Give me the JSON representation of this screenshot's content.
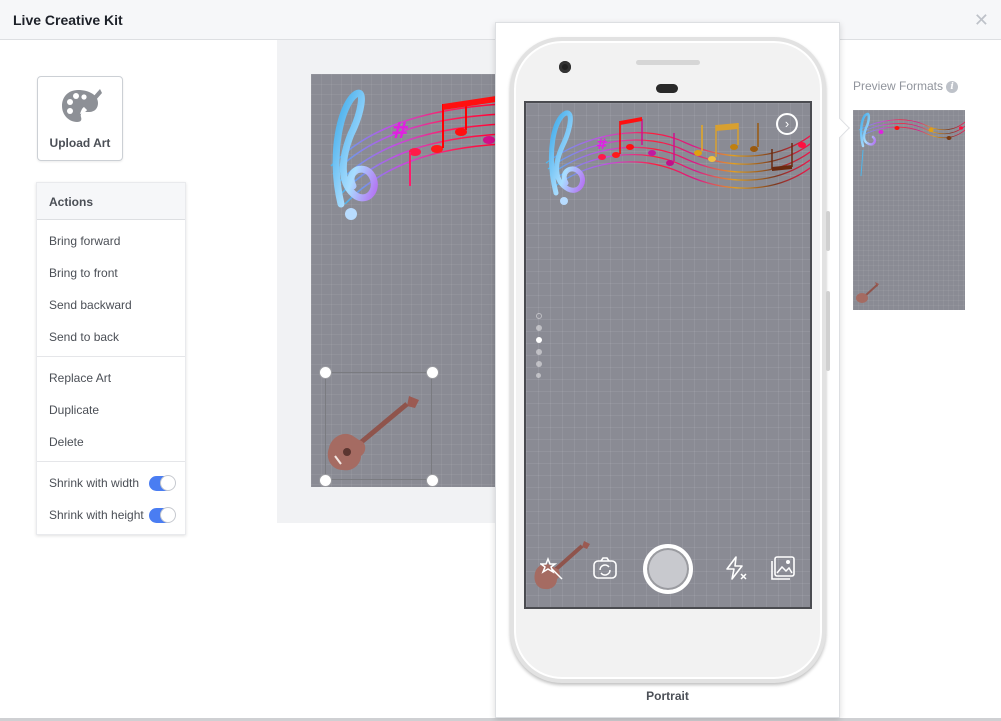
{
  "window": {
    "title": "Live Creative Kit",
    "close_icon": "close-icon"
  },
  "sidebar": {
    "upload_art": {
      "label": "Upload Art",
      "icon": "palette-icon"
    },
    "actions": {
      "header": "Actions",
      "groups": [
        [
          "Bring forward",
          "Bring to front",
          "Send backward",
          "Send to back"
        ],
        [
          "Replace Art",
          "Duplicate",
          "Delete"
        ]
      ],
      "toggles": [
        {
          "label": "Shrink with width",
          "on": true
        },
        {
          "label": "Shrink with height",
          "on": true
        }
      ]
    }
  },
  "canvas": {
    "layers": [
      "music-staff-art",
      "ukulele-art"
    ],
    "selected_layer": "ukulele-art"
  },
  "preview": {
    "format_label": "Portrait",
    "next_icon": "chevron-right-icon",
    "filter_dots": {
      "count": 6,
      "active_index": 2
    },
    "controls": [
      "effects-icon",
      "flip-camera-icon",
      "shutter-button",
      "flash-off-icon",
      "gallery-icon"
    ]
  },
  "preview_formats": {
    "label": "Preview Formats",
    "info_icon": "info-icon",
    "info_glyph": "i"
  },
  "colors": {
    "toggle_on": "#4a7df2",
    "canvas_bg": "#8a8b94",
    "text_dark": "#1d2129",
    "text_label": "#4b4f56"
  }
}
